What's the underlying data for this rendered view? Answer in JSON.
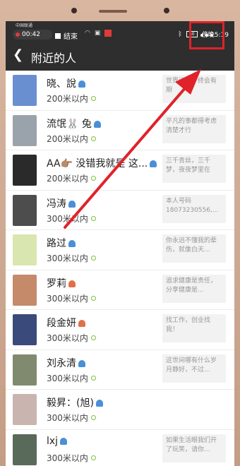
{
  "status_bar": {
    "carrier": "中国联通",
    "recording_time": "00:42",
    "end_label": "结束",
    "battery": "60",
    "time": "傍晚5:19"
  },
  "nav": {
    "back_icon": "chevron-left-icon",
    "title": "附近的人",
    "more_icon": "more-dots-icon"
  },
  "people": [
    {
      "name": "晓、說",
      "gender": "male",
      "distance": "200米以内",
      "signature": "世界辽阔，终会有期",
      "avatar_color": "#6a8fd0"
    },
    {
      "name": "流氓🐰 兔",
      "gender": "male",
      "distance": "200米以内",
      "signature": "平凡的事都得考虑清楚才行",
      "avatar_color": "#9aa3ab"
    },
    {
      "name": "AA👉🏽 没错我就是 这...",
      "gender": "male",
      "distance": "200米以内",
      "signature": "三千青丝，三千梦，夜夜梦里在",
      "avatar_color": "#2a2a2a"
    },
    {
      "name": "冯涛",
      "gender": "male",
      "distance": "300米以内",
      "signature": "本人号码 18073230556,...",
      "avatar_color": "#4d4d4d"
    },
    {
      "name": "路过",
      "gender": "male",
      "distance": "300米以内",
      "signature": "你永远不懂我的辈伤，就像白天...",
      "avatar_color": "#d9e6b0"
    },
    {
      "name": "罗莉",
      "gender": "female",
      "distance": "300米以内",
      "signature": "追求健康是责任，分享健康是...",
      "avatar_color": "#c48a6a"
    },
    {
      "name": "段金妍",
      "gender": "female",
      "distance": "300米以内",
      "signature": "找工作，创业找我！",
      "avatar_color": "#3a4a7a"
    },
    {
      "name": "刘永清",
      "gender": "male",
      "distance": "300米以内",
      "signature": "这世间哪有什么岁月静好，不过...",
      "avatar_color": "#7f8a6f"
    },
    {
      "name": "毅昇：(旭)",
      "gender": "male",
      "distance": "300米以内",
      "signature": "",
      "avatar_color": "#c9b4b0"
    },
    {
      "name": "lxj",
      "gender": "male",
      "distance": "300米以内",
      "signature": "如果生活眼我们开了玩笑，请你...",
      "avatar_color": "#5a6a5a"
    }
  ],
  "colors": {
    "male_icon": "#4a8fd8",
    "female_icon": "#e0704a",
    "highlight": "#e0222a"
  }
}
